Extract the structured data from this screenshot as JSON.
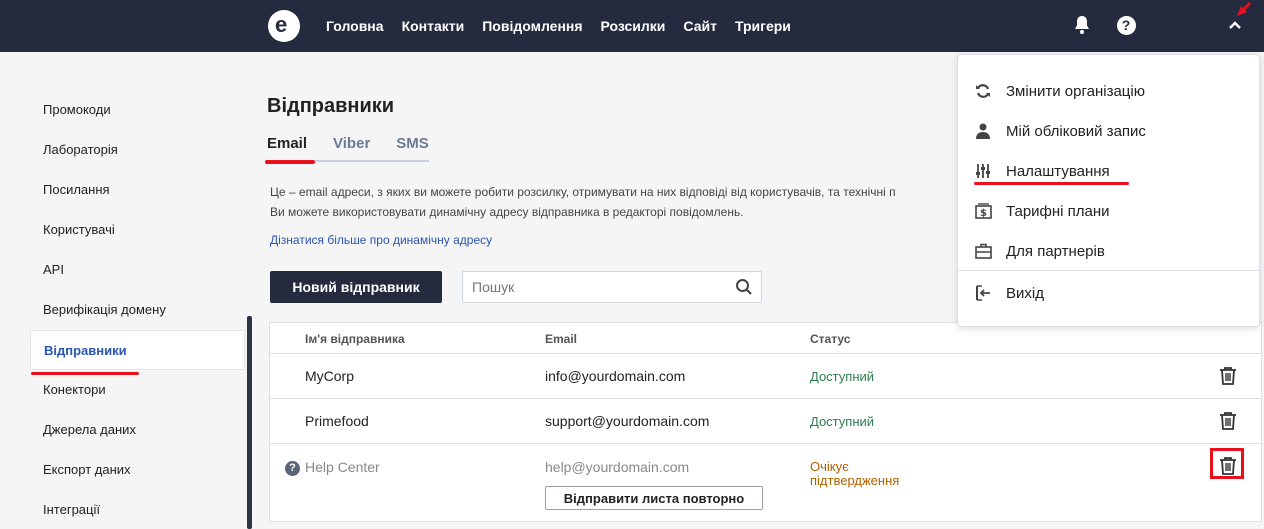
{
  "nav": {
    "items": [
      "Головна",
      "Контакти",
      "Повідомлення",
      "Розсилки",
      "Сайт",
      "Тригери"
    ]
  },
  "sidebar": {
    "items": [
      {
        "label": "Промокоди"
      },
      {
        "label": "Лабораторія"
      },
      {
        "label": "Посилання"
      },
      {
        "label": "Користувачі"
      },
      {
        "label": "API"
      },
      {
        "label": "Верифікація домену"
      },
      {
        "label": "Відправники",
        "active": true
      },
      {
        "label": "Конектори"
      },
      {
        "label": "Джерела даних"
      },
      {
        "label": "Експорт даних"
      },
      {
        "label": "Інтеграції"
      }
    ]
  },
  "page": {
    "title": "Відправники",
    "tabs": [
      "Email",
      "Viber",
      "SMS"
    ],
    "description_line1": "Це – email адреси, з яких ви можете робити розсилку, отримувати на них відповіді від користувачів, та технічні п",
    "description_line2": "Ви можете використовувати динамічну адресу відправника в редакторі повідомлень.",
    "link": "Дізнатися більше про динамічну адресу",
    "new_button": "Новий відправник",
    "search_placeholder": "Пошук"
  },
  "table": {
    "headers": [
      "Ім'я відправника",
      "Email",
      "Статус"
    ],
    "rows": [
      {
        "name": "MyCorp",
        "email": "info@yourdomain.com",
        "status": "Доступний"
      },
      {
        "name": "Primefood",
        "email": "support@yourdomain.com",
        "status": "Доступний"
      },
      {
        "name": "Help Center",
        "email": "help@yourdomain.com",
        "status_line1": "Очікує",
        "status_line2": "підтвердження",
        "resend": "Відправити листа повторно"
      }
    ]
  },
  "menu": {
    "items": [
      {
        "label": "Змінити організацію",
        "icon": "refresh-icon"
      },
      {
        "label": "Мій обліковий запис",
        "icon": "user-icon"
      },
      {
        "label": "Налаштування",
        "icon": "sliders-icon"
      },
      {
        "label": "Тарифні плани",
        "icon": "billing-icon"
      },
      {
        "label": "Для партнерів",
        "icon": "briefcase-icon"
      },
      {
        "label": "Вихід",
        "icon": "logout-icon"
      }
    ]
  },
  "colors": {
    "topbar": "#252b3f",
    "accent_red": "#e8101b",
    "link_blue": "#2a55b3",
    "status_ok": "#2e7d4f",
    "status_pending": "#b06100"
  }
}
